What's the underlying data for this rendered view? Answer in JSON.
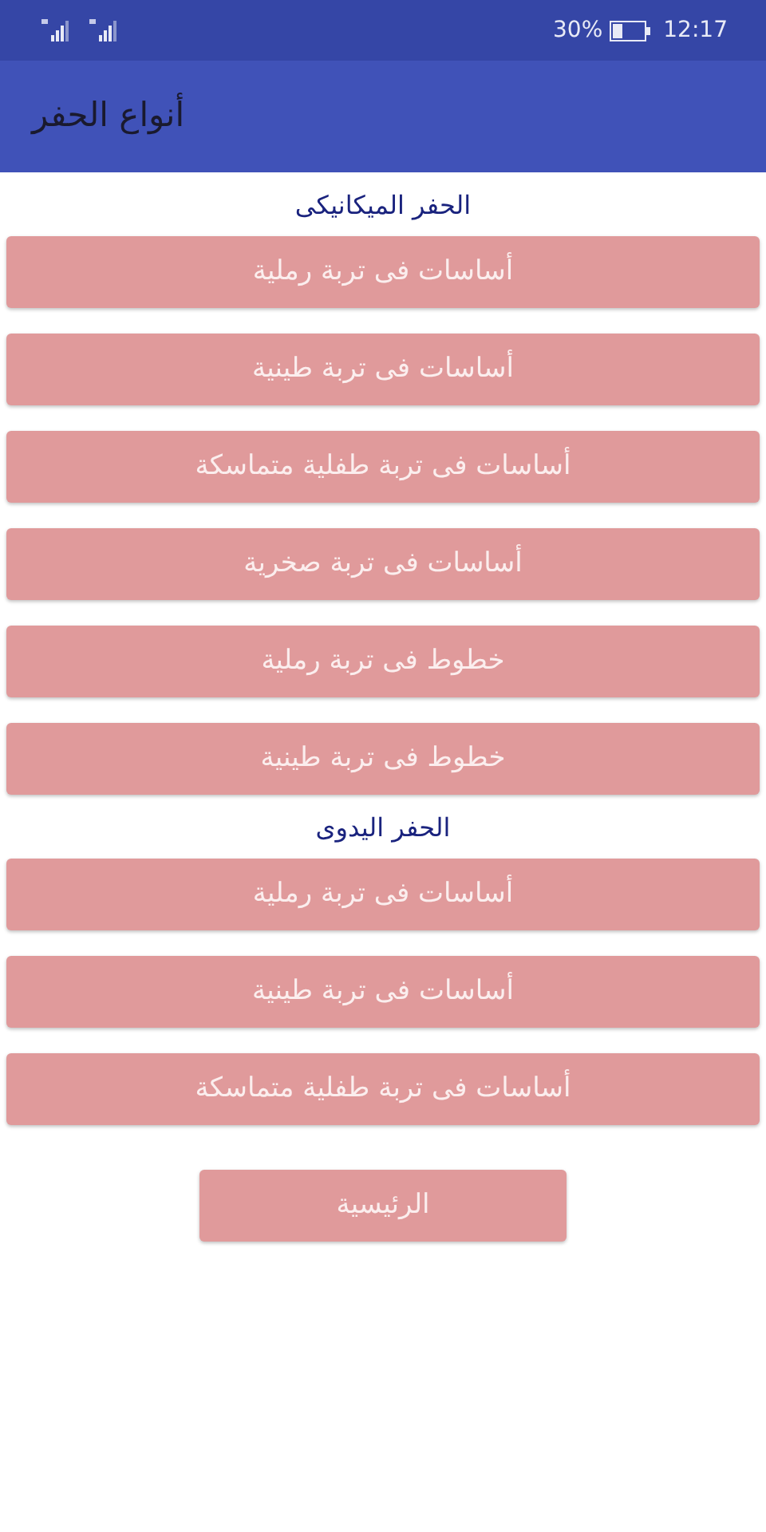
{
  "status_bar": {
    "battery_text": "30%",
    "time": "12:17"
  },
  "app_bar": {
    "title": "أنواع الحفر"
  },
  "sections": [
    {
      "title": "الحفر الميكانيكى",
      "buttons": [
        "أساسات فى تربة رملية",
        "أساسات فى تربة طينية",
        "أساسات فى تربة طفلية متماسكة",
        "أساسات فى تربة صخرية",
        "خطوط فى تربة رملية",
        "خطوط فى تربة طينية"
      ]
    },
    {
      "title": "الحفر اليدوى",
      "buttons": [
        "أساسات فى تربة رملية",
        "أساسات فى تربة طينية",
        "أساسات فى تربة طفلية متماسكة"
      ]
    }
  ],
  "home_button": "الرئيسية"
}
